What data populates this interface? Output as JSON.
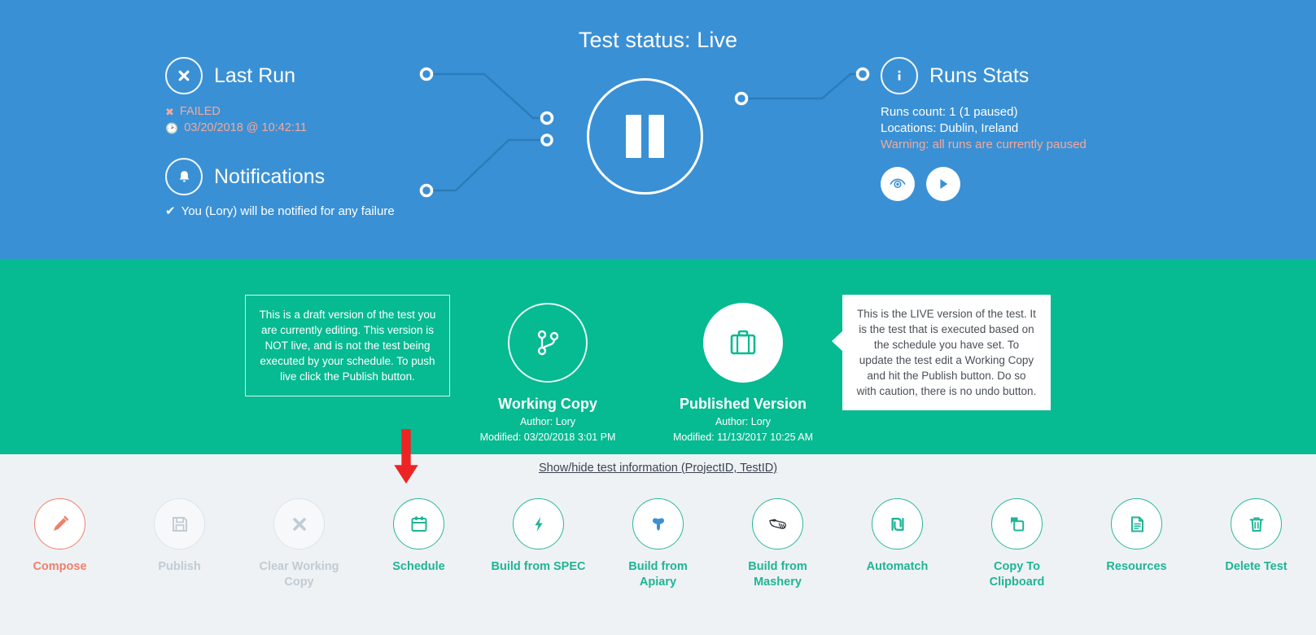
{
  "header": {
    "status_title": "Test status: Live",
    "pause_button": "pause-button"
  },
  "last_run": {
    "icon": "x-circle-icon",
    "title": "Last Run",
    "result": "FAILED",
    "timestamp": "03/20/2018 @ 10:42:11"
  },
  "notifications": {
    "icon": "bell-icon",
    "title": "Notifications",
    "message": "You (Lory) will be notified for any failure"
  },
  "runs_stats": {
    "icon": "info-icon",
    "title": "Runs Stats",
    "runs_count": "Runs count: 1 (1 paused)",
    "locations": "Locations: Dublin, Ireland",
    "warning": "Warning: all runs are currently paused",
    "actions": [
      {
        "name": "view-runs-button",
        "icon": "eye-icon"
      },
      {
        "name": "resume-runs-button",
        "icon": "play-icon"
      }
    ]
  },
  "versions": {
    "working_copy": {
      "icon": "branch-icon",
      "title": "Working Copy",
      "author": "Author: Lory",
      "modified": "Modified: 03/20/2018 3:01 PM",
      "tooltip": "This is a draft version of the test you are currently editing. This version is NOT live, and is not the test being executed by your schedule. To push live click the Publish button."
    },
    "published_version": {
      "icon": "briefcase-icon",
      "title": "Published Version",
      "author": "Author: Lory",
      "modified": "Modified: 11/13/2017 10:25 AM",
      "tooltip": "This is the LIVE version of the test. It is the test that is executed based on the schedule you have set. To update the test edit a Working Copy and hit the Publish button. Do so with caution, there is no undo button."
    }
  },
  "info_link": "Show/hide test information (ProjectID, TestID)",
  "toolbar": {
    "items": [
      {
        "label": "Compose",
        "icon": "pencil-icon",
        "state": "compose"
      },
      {
        "label": "Publish",
        "icon": "save-icon",
        "state": "disabled"
      },
      {
        "label": "Clear Working Copy",
        "icon": "x-icon",
        "state": "disabled"
      },
      {
        "label": "Schedule",
        "icon": "calendar-icon",
        "state": "normal"
      },
      {
        "label": "Build from SPEC",
        "icon": "bolt-icon",
        "state": "normal"
      },
      {
        "label": "Build from Apiary",
        "icon": "apiary-icon",
        "state": "normal"
      },
      {
        "label": "Build from Mashery",
        "icon": "mashery-icon",
        "state": "normal"
      },
      {
        "label": "Automatch",
        "icon": "shekel-icon",
        "state": "normal"
      },
      {
        "label": "Copy To Clipboard",
        "icon": "copy-icon",
        "state": "normal"
      },
      {
        "label": "Resources",
        "icon": "document-icon",
        "state": "normal"
      },
      {
        "label": "Delete Test",
        "icon": "trash-icon",
        "state": "normal"
      }
    ]
  },
  "annotation": {
    "arrow": "red-down-arrow pointing at Schedule"
  },
  "colors": {
    "blue": "#3a90d4",
    "green": "#06ba92",
    "light_bg": "#eef2f5",
    "salmon": "#ef7f6b",
    "warning": "#f4a99a",
    "teal_text": "#1fb496",
    "arrow_red": "#ee2323"
  }
}
